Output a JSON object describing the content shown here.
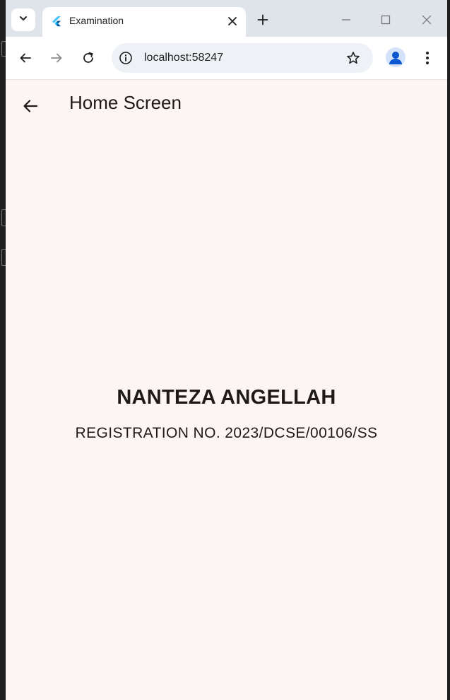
{
  "browser": {
    "tab": {
      "title": "Examination",
      "favicon": "flutter-icon"
    },
    "address_bar": {
      "url": "localhost:58247"
    },
    "icons": {
      "tab_search": "chevron-down-icon",
      "tab_close": "close-icon",
      "new_tab": "plus-icon",
      "minimize": "minimize-icon",
      "maximize": "maximize-icon",
      "close_window": "close-icon",
      "back": "arrow-left-icon",
      "forward": "arrow-right-icon",
      "reload": "reload-icon",
      "site_info": "info-icon",
      "bookmark": "star-icon",
      "profile": "account-icon",
      "menu": "kebab-menu-icon"
    }
  },
  "app": {
    "appbar": {
      "title": "Home Screen",
      "back_icon": "arrow-left-icon"
    },
    "student": {
      "name": "NANTEZA ANGELLAH",
      "registration": "REGISTRATION NO. 2023/DCSE/00106/SS"
    }
  },
  "colors": {
    "page_background": "#fdf5f4",
    "tabstrip": "#dfe3ea",
    "omnibox": "#eef1f6",
    "text": "#1f1a1a",
    "profile_accent": "#0b57d0"
  }
}
